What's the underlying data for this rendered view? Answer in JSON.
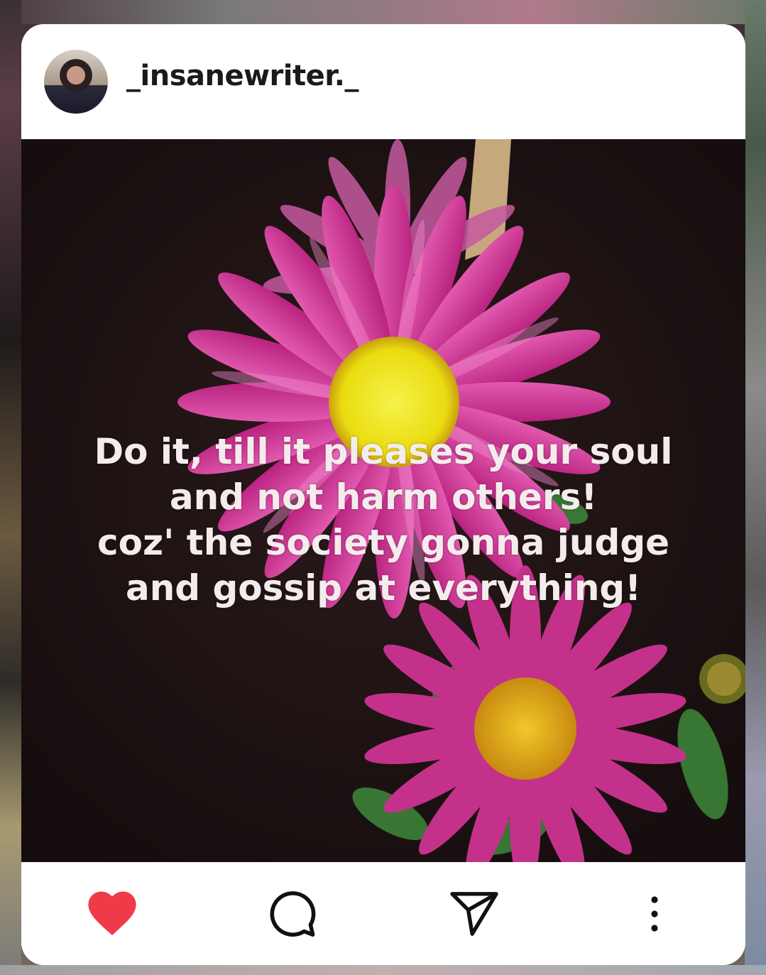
{
  "post": {
    "username": "_insanewriter._",
    "quote_lines": [
      "Do it, till it pleases your soul",
      "and not harm others!",
      "coz' the society gonna judge",
      "and gossip at everything!"
    ],
    "liked": true
  },
  "icons": {
    "like": "heart-icon",
    "comment": "comment-bubble-icon",
    "share": "send-paper-plane-icon",
    "more": "more-vertical-dots-icon"
  },
  "colors": {
    "like_red": "#f03a47",
    "icon_dark": "#111111",
    "card_bg": "#ffffff",
    "quote_text": "#f4ecec",
    "petal_pink": "#d83a9c",
    "flower_center": "#f2ea1a"
  }
}
